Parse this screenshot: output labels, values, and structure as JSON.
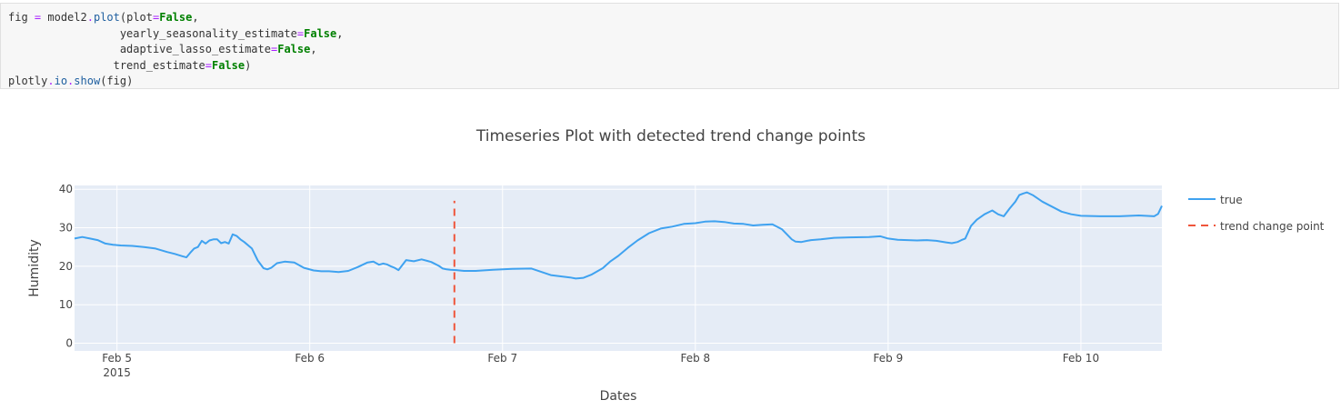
{
  "code_cell": {
    "lines": [
      [
        {
          "t": "fig",
          "c": "nm"
        },
        {
          "t": " ",
          "c": "nm"
        },
        {
          "t": "=",
          "c": "op"
        },
        {
          "t": " model2",
          "c": "nm"
        },
        {
          "t": ".",
          "c": "op"
        },
        {
          "t": "plot",
          "c": "attr"
        },
        {
          "t": "(plot",
          "c": "nm"
        },
        {
          "t": "=",
          "c": "op"
        },
        {
          "t": "False",
          "c": "kw"
        },
        {
          "t": ",",
          "c": "nm"
        }
      ],
      [
        {
          "t": "                 yearly_seasonality_estimate",
          "c": "nm"
        },
        {
          "t": "=",
          "c": "op"
        },
        {
          "t": "False",
          "c": "kw"
        },
        {
          "t": ",",
          "c": "nm"
        }
      ],
      [
        {
          "t": "                 adaptive_lasso_estimate",
          "c": "nm"
        },
        {
          "t": "=",
          "c": "op"
        },
        {
          "t": "False",
          "c": "kw"
        },
        {
          "t": ",",
          "c": "nm"
        }
      ],
      [
        {
          "t": "                trend_estimate",
          "c": "nm"
        },
        {
          "t": "=",
          "c": "op"
        },
        {
          "t": "False",
          "c": "kw"
        },
        {
          "t": ")",
          "c": "nm"
        }
      ],
      [
        {
          "t": "plotly",
          "c": "nm"
        },
        {
          "t": ".",
          "c": "op"
        },
        {
          "t": "io",
          "c": "attr"
        },
        {
          "t": ".",
          "c": "op"
        },
        {
          "t": "show",
          "c": "attr"
        },
        {
          "t": "(fig)",
          "c": "nm"
        }
      ]
    ]
  },
  "chart_data": {
    "type": "line",
    "title": "Timeseries Plot with detected trend change points",
    "xlabel": "Dates",
    "ylabel": "Humidity",
    "x_unit": "days since Feb 4 2015 00:00",
    "xlim": [
      0.78,
      6.42
    ],
    "ylim": [
      -2,
      41
    ],
    "x_ticks": [
      {
        "value": 1,
        "label": "Feb 5",
        "sublabel": "2015"
      },
      {
        "value": 2,
        "label": "Feb 6",
        "sublabel": ""
      },
      {
        "value": 3,
        "label": "Feb 7",
        "sublabel": ""
      },
      {
        "value": 4,
        "label": "Feb 8",
        "sublabel": ""
      },
      {
        "value": 5,
        "label": "Feb 9",
        "sublabel": ""
      },
      {
        "value": 6,
        "label": "Feb 10",
        "sublabel": ""
      }
    ],
    "y_ticks": [
      0,
      10,
      20,
      30,
      40
    ],
    "grid": true,
    "plot_bgcolor": "#e5ecf6",
    "legend_position": "right",
    "series": [
      {
        "name": "true",
        "color": "#3fa2f0",
        "dash": "solid",
        "x": [
          0.78,
          0.82,
          0.86,
          0.9,
          0.94,
          0.98,
          1.02,
          1.08,
          1.14,
          1.2,
          1.26,
          1.3,
          1.34,
          1.36,
          1.38,
          1.4,
          1.42,
          1.44,
          1.46,
          1.48,
          1.5,
          1.52,
          1.54,
          1.56,
          1.58,
          1.6,
          1.62,
          1.64,
          1.66,
          1.7,
          1.73,
          1.76,
          1.78,
          1.8,
          1.83,
          1.87,
          1.92,
          1.97,
          2.02,
          2.06,
          2.1,
          2.15,
          2.2,
          2.25,
          2.3,
          2.33,
          2.36,
          2.38,
          2.4,
          2.42,
          2.44,
          2.46,
          2.5,
          2.54,
          2.58,
          2.61,
          2.63,
          2.65,
          2.67,
          2.69,
          2.71,
          2.73,
          2.76,
          2.8,
          2.86,
          2.95,
          3.05,
          3.15,
          3.25,
          3.35,
          3.38,
          3.42,
          3.46,
          3.52,
          3.56,
          3.6,
          3.65,
          3.7,
          3.76,
          3.82,
          3.88,
          3.94,
          4.0,
          4.05,
          4.1,
          4.15,
          4.2,
          4.25,
          4.3,
          4.35,
          4.4,
          4.45,
          4.5,
          4.52,
          4.55,
          4.58,
          4.6,
          4.65,
          4.72,
          4.8,
          4.9,
          4.96,
          5.0,
          5.05,
          5.1,
          5.15,
          5.2,
          5.25,
          5.3,
          5.33,
          5.36,
          5.38,
          5.4,
          5.43,
          5.46,
          5.5,
          5.52,
          5.54,
          5.57,
          5.6,
          5.63,
          5.66,
          5.68,
          5.7,
          5.72,
          5.75,
          5.8,
          5.85,
          5.9,
          5.95,
          6.0,
          6.1,
          6.2,
          6.3,
          6.38,
          6.4,
          6.42
        ],
        "y": [
          27.2,
          27.6,
          27.2,
          26.8,
          25.9,
          25.6,
          25.4,
          25.3,
          25.0,
          24.6,
          23.7,
          23.2,
          22.6,
          22.3,
          23.5,
          24.6,
          25.0,
          26.6,
          25.9,
          26.7,
          27.0,
          27.0,
          26.0,
          26.3,
          25.9,
          28.3,
          27.9,
          27.0,
          26.3,
          24.6,
          21.5,
          19.5,
          19.2,
          19.6,
          20.8,
          21.2,
          21.0,
          19.6,
          18.9,
          18.7,
          18.7,
          18.5,
          18.8,
          19.8,
          21.0,
          21.2,
          20.4,
          20.7,
          20.5,
          20.0,
          19.6,
          19.0,
          21.6,
          21.3,
          21.8,
          21.4,
          21.1,
          20.6,
          20.1,
          19.4,
          19.2,
          19.1,
          19.0,
          18.8,
          18.8,
          19.1,
          19.3,
          19.4,
          17.7,
          17.1,
          16.8,
          17.0,
          17.8,
          19.5,
          21.3,
          22.7,
          24.8,
          26.7,
          28.6,
          29.8,
          30.3,
          31.0,
          31.2,
          31.6,
          31.7,
          31.5,
          31.1,
          31.0,
          30.6,
          30.8,
          30.9,
          29.6,
          27.0,
          26.4,
          26.3,
          26.6,
          26.8,
          27.0,
          27.4,
          27.5,
          27.6,
          27.8,
          27.2,
          26.9,
          26.8,
          26.7,
          26.8,
          26.6,
          26.2,
          26.0,
          26.3,
          26.8,
          27.2,
          30.5,
          32.1,
          33.5,
          34.0,
          34.5,
          33.5,
          33.0,
          35.0,
          36.8,
          38.5,
          38.9,
          39.2,
          38.5,
          36.8,
          35.5,
          34.2,
          33.5,
          33.1,
          33.0,
          33.0,
          33.2,
          33.0,
          33.6,
          35.7
        ]
      },
      {
        "name": "trend change point",
        "color": "#ef553b",
        "dash": "dash",
        "x": [
          2.75,
          2.75
        ],
        "y": [
          0,
          37
        ]
      }
    ]
  }
}
